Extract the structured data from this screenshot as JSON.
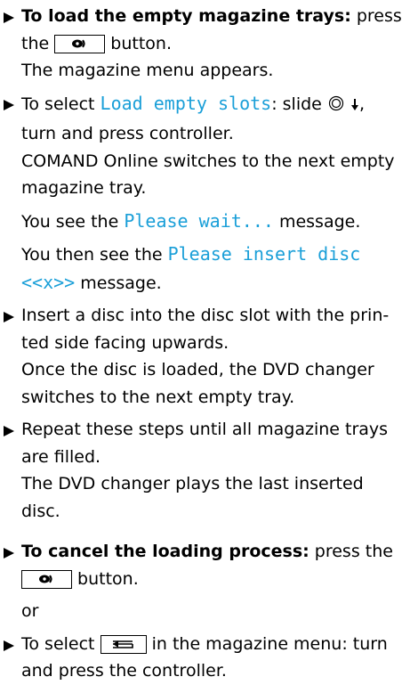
{
  "blocks": {
    "load_heading": "To load the empty magazine trays:",
    "load_press": " press the",
    "load_button_suffix": " button.",
    "menu_appears": "The magazine menu appears.",
    "select_prefix": "To select ",
    "load_empty_slots": "Load empty slots",
    "select_mid": ": slide ",
    "select_suffix": ", turn and press controller.",
    "switches": "COMAND Online switches to the next empty magazine tray.",
    "you_see": "You see the ",
    "please_wait": "Please wait...",
    "message_suffix": " message.",
    "you_then_see": "You then see the ",
    "please_insert": "Please insert disc <<x>>",
    "message_suffix2": " message.",
    "insert_disc": "Insert a disc into the disc slot with the prin­ted side facing upwards.",
    "once_loaded": "Once the disc is loaded, the DVD changer switches to the next empty tray.",
    "repeat": "Repeat these steps until all magazine trays are filled.",
    "plays_last": "The DVD changer plays the last inserted disc.",
    "cancel_heading": "To cancel the loading process:",
    "cancel_press": " press the",
    "cancel_button_suffix": " button.",
    "or": "or",
    "select_back_prefix": "To select ",
    "select_back_suffix": " in the magazine menu: turn and press the controller."
  },
  "icons": {
    "bullet": "arrow-right-icon",
    "disc_button": "disc-eject-button-icon",
    "controller": "controller-icon",
    "slide_down": "slide-down-arrow-icon",
    "back": "back-icon"
  },
  "colors": {
    "highlight": "#1a9fd8",
    "text": "#000000"
  }
}
